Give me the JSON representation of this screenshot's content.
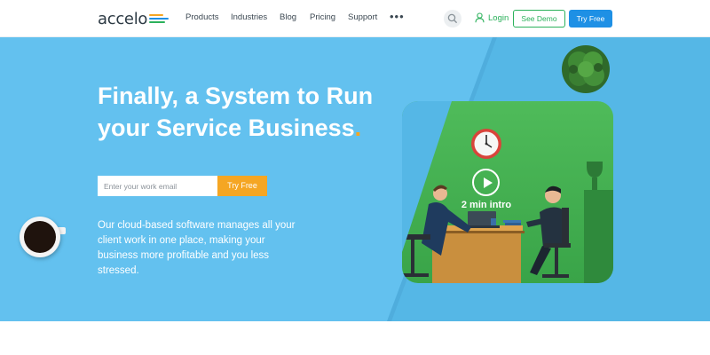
{
  "nav": {
    "logo": "accelo",
    "links": [
      "Products",
      "Industries",
      "Blog",
      "Pricing",
      "Support"
    ],
    "more": "•••",
    "login": "Login",
    "see_demo": "See Demo",
    "try_free": "Try Free"
  },
  "hero": {
    "title_line1": "Finally, a System to Run",
    "title_line2": "your Service Business",
    "title_dot": ".",
    "email_placeholder": "Enter your work email",
    "try_free": "Try Free",
    "description": "Our cloud-based software manages all your client work in one place, making your business more profitable and you less stressed.",
    "video_caption": "2 min intro"
  },
  "colors": {
    "hero_bg": "#63c1ef",
    "accent_orange": "#f5a623",
    "accent_green": "#2bb15b",
    "accent_blue": "#1e90e5"
  },
  "icons": [
    "logo-mark-icon",
    "search-icon",
    "user-icon",
    "play-icon",
    "clock-icon",
    "plant-icon",
    "coffee-cup-icon"
  ]
}
